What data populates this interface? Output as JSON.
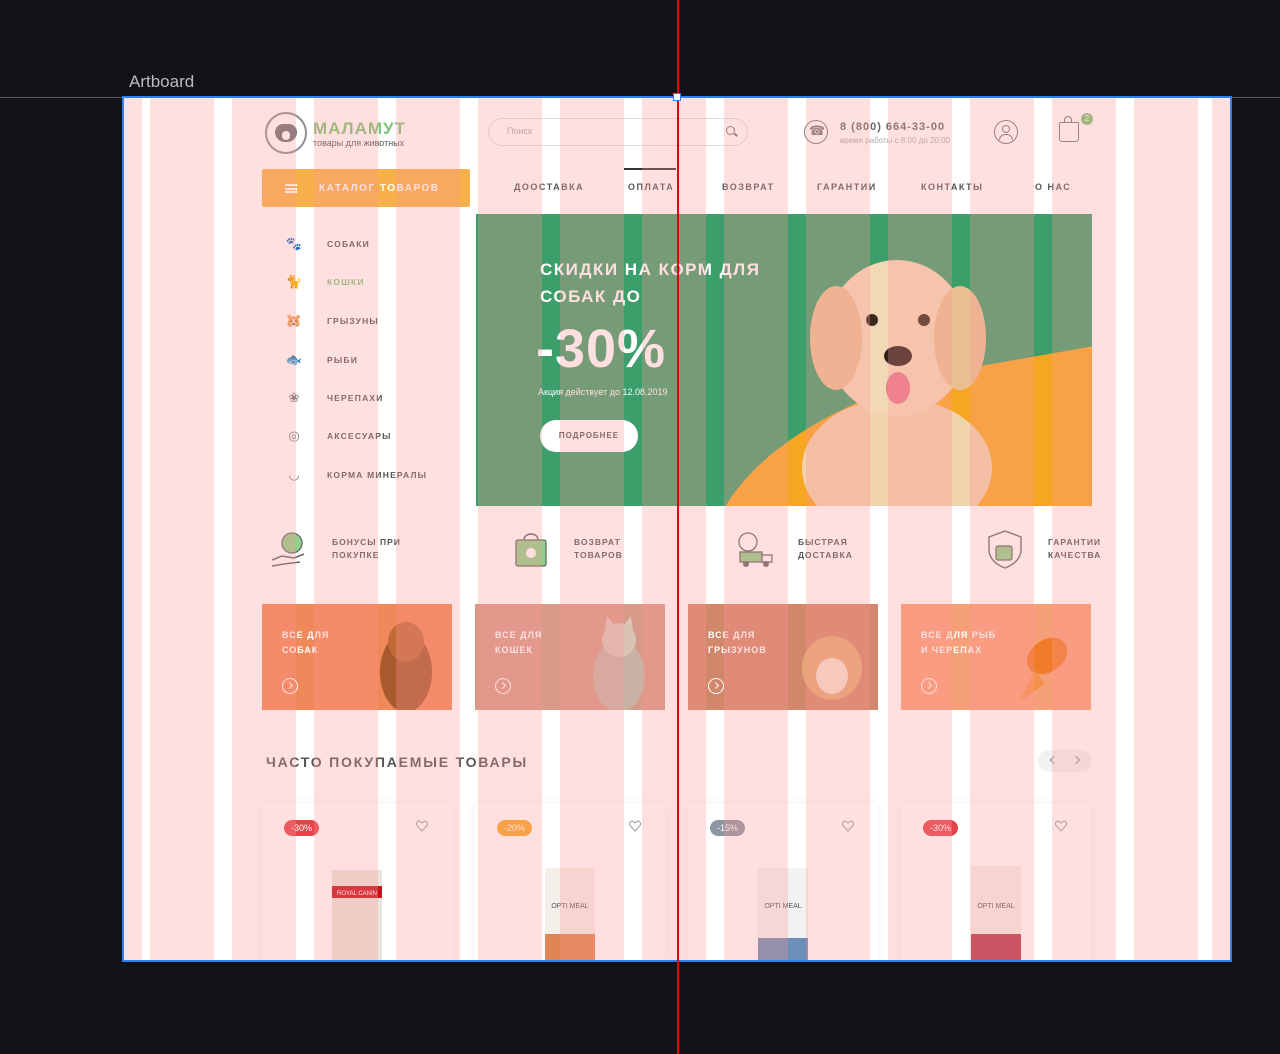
{
  "editor": {
    "artboard_label": "Artboard"
  },
  "header": {
    "logo_name": "МАЛАМУТ",
    "logo_tagline": "товары для животных",
    "search_placeholder": "Поиск",
    "phone": "8 (800) 664-33-00",
    "work_hours": "время работы с 8:00 до 20:00",
    "cart_count": "2"
  },
  "nav": {
    "catalog_label": "КАТАЛОГ ТОВАРОВ",
    "items": [
      {
        "label": "ДООСТАВКА"
      },
      {
        "label": "ОПЛАТА"
      },
      {
        "label": "ВОЗВРАТ"
      },
      {
        "label": "ГАРАНТИИ"
      },
      {
        "label": "КОНТАКТЫ"
      },
      {
        "label": "О НАС"
      }
    ]
  },
  "sidebar": {
    "items": [
      {
        "label": "СОБАКИ",
        "icon": "dog-icon"
      },
      {
        "label": "КОШКИ",
        "icon": "cat-icon",
        "active": true
      },
      {
        "label": "ГРЫЗУНЫ",
        "icon": "rodent-icon"
      },
      {
        "label": "РЫБИ",
        "icon": "fish-icon"
      },
      {
        "label": "ЧЕРЕПАХИ",
        "icon": "turtle-icon"
      },
      {
        "label": "АКСЕСУАРЫ",
        "icon": "collar-icon"
      },
      {
        "label": "КОРМА МИНЕРАЛЫ",
        "icon": "bowl-icon"
      }
    ]
  },
  "banner": {
    "title": "СКИДКИ НА КОРМ ДЛЯ СОБАК ДО",
    "discount": "-30%",
    "note": "Акция действует до 12.08.2019",
    "button": "ПОДРОБНЕЕ"
  },
  "features": [
    {
      "label": "БОНУСЫ ПРИ\nПОКУПКЕ",
      "icon": "bonus-hand-icon"
    },
    {
      "label": "ВОЗВРАТ\nТОВАРОВ",
      "icon": "return-bag-icon"
    },
    {
      "label": "БЫСТРАЯ\nДОСТАВКА",
      "icon": "delivery-truck-icon"
    },
    {
      "label": "ГАРАНТИИ\nКАЧЕСТВА",
      "icon": "quality-shield-icon"
    }
  ],
  "categories": [
    {
      "label": "ВСЕ ДЛЯ\nСОБАК"
    },
    {
      "label": "ВСЕ ДЛЯ\nКОШЕК"
    },
    {
      "label": "ВСЕ ДЛЯ\nГРЫЗУНОВ"
    },
    {
      "label": "ВСЕ ДЛЯ РЫБ\nИ ЧЕРЕПАХ"
    }
  ],
  "popular": {
    "title": "ЧАСТО ПОКУПАЕМЫЕ ТОВАРЫ",
    "products": [
      {
        "badge": "-30%",
        "badge_color": "#e3434a",
        "brand": "ROYAL CANIN"
      },
      {
        "badge": "-20%",
        "badge_color": "#f7a624",
        "brand": "OPTI MEAL"
      },
      {
        "badge": "-15%",
        "badge_color": "#8b96a0",
        "brand": "OPTI MEAL"
      },
      {
        "badge": "-30%",
        "badge_color": "#e3434a",
        "brand": "OPTI MEAL"
      }
    ]
  },
  "colors": {
    "grid_overlay": "#ff9494",
    "artboard_border": "#2f80ed",
    "center_guide": "#d10f10",
    "brand_green": "#7cc576",
    "accent_orange": "#f7b04a"
  }
}
